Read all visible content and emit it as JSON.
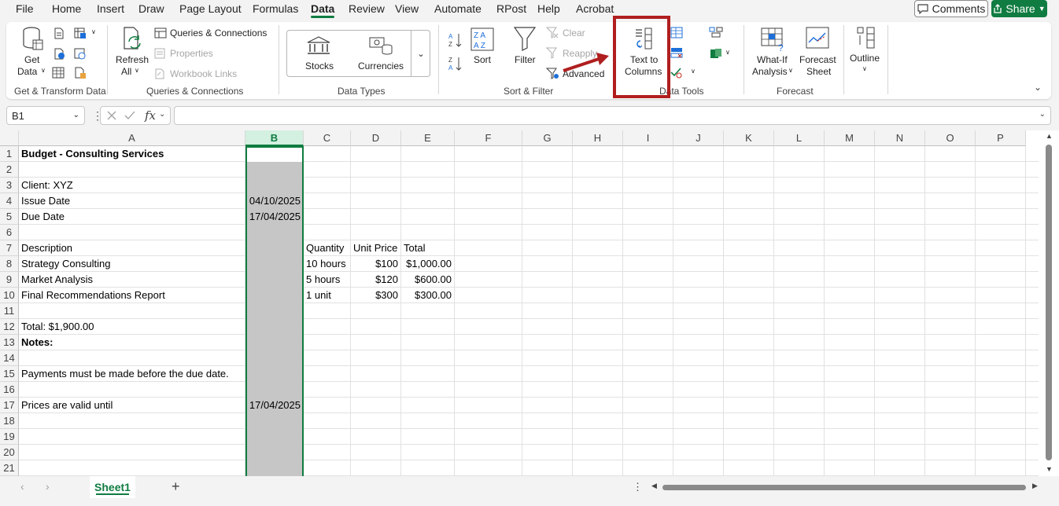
{
  "menu": {
    "items": [
      "File",
      "Home",
      "Insert",
      "Draw",
      "Page Layout",
      "Formulas",
      "Data",
      "Review",
      "View",
      "Automate",
      "RPost",
      "Help",
      "Acrobat"
    ],
    "active": "Data",
    "comments_label": "Comments",
    "share_label": "Share"
  },
  "ribbon": {
    "get_transform": {
      "get_data_line1": "Get",
      "get_data_line2": "Data",
      "group_label": "Get & Transform Data"
    },
    "queries": {
      "refresh_line1": "Refresh",
      "refresh_line2": "All",
      "queries_connections": "Queries & Connections",
      "properties": "Properties",
      "workbook_links": "Workbook Links",
      "group_label": "Queries & Connections"
    },
    "data_types": {
      "stocks": "Stocks",
      "currencies": "Currencies",
      "group_label": "Data Types"
    },
    "sort_filter": {
      "sort": "Sort",
      "filter": "Filter",
      "clear": "Clear",
      "reapply": "Reapply",
      "advanced": "Advanced",
      "group_label": "Sort & Filter"
    },
    "data_tools": {
      "text_to_columns_line1": "Text to",
      "text_to_columns_line2": "Columns",
      "group_label": "Data Tools"
    },
    "forecast": {
      "what_if_line1": "What-If",
      "what_if_line2": "Analysis",
      "forecast_sheet_line1": "Forecast",
      "forecast_sheet_line2": "Sheet",
      "group_label": "Forecast"
    },
    "outline": {
      "label": "Outline"
    }
  },
  "formula_bar": {
    "name_box": "B1",
    "fx": "fx",
    "formula": ""
  },
  "grid": {
    "columns": [
      "A",
      "B",
      "C",
      "D",
      "E",
      "F",
      "G",
      "H",
      "I",
      "J",
      "K",
      "L",
      "M",
      "N",
      "O",
      "P"
    ],
    "selected_column": "B",
    "rows": [
      "1",
      "2",
      "3",
      "4",
      "5",
      "6",
      "7",
      "8",
      "9",
      "10",
      "11",
      "12",
      "13",
      "14",
      "15",
      "16",
      "17",
      "18",
      "19",
      "20",
      "21"
    ],
    "cells": {
      "A1": "Budget - Consulting Services",
      "A3": "Client: XYZ",
      "A4": "Issue Date",
      "B4": "04/10/2025",
      "A5": "Due Date",
      "B5": "17/04/2025",
      "A7": "Description",
      "C7": "Quantity",
      "D7": "Unit Price",
      "E7": "Total",
      "A8": "Strategy Consulting",
      "C8": "10 hours",
      "D8": "$100",
      "E8": "$1,000.00",
      "A9": "Market Analysis",
      "C9": "5 hours",
      "D9": "$120",
      "E9": "$600.00",
      "A10": "Final Recommendations Report",
      "C10": "1 unit",
      "D10": "$300",
      "E10": "$300.00",
      "A12": "Total: $1,900.00",
      "A13": "Notes:",
      "A15": "Payments must be made before the due date.",
      "A17": "Prices are valid until",
      "B17": "17/04/2025"
    }
  },
  "sheets": {
    "active": "Sheet1",
    "add_label": "+"
  },
  "colors": {
    "accent": "#107c41",
    "highlight": "#b01e1e",
    "selection_fill": "#c6c6c6"
  }
}
